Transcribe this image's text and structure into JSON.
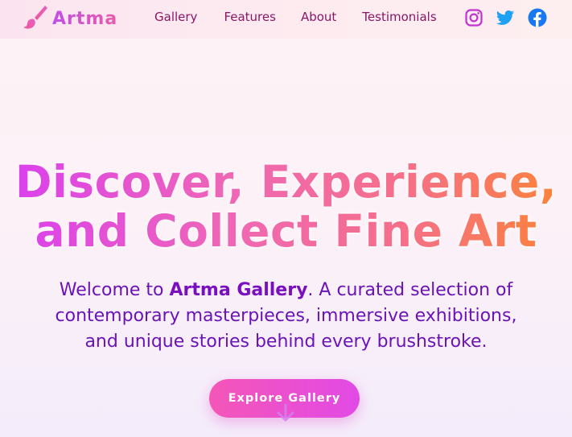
{
  "header": {
    "brand": "Artma",
    "nav": [
      "Gallery",
      "Features",
      "About",
      "Testimonials"
    ],
    "social_icons": [
      "instagram-icon",
      "twitter-icon",
      "facebook-icon"
    ]
  },
  "hero": {
    "title_line1": "Discover, Experience,",
    "title_line2": "and Collect Fine Art",
    "subtitle_pre": "Welcome to ",
    "subtitle_brand": "Artma Gallery",
    "subtitle_line1_rest": ". A curated selection of",
    "subtitle_line2": "contemporary masterpieces, immersive exhibitions,",
    "subtitle_line3": "and unique stories behind every brushstroke.",
    "cta_label": "Explore Gallery"
  },
  "colors": {
    "brand_pink": "#e85aa8",
    "brand_purple": "#c34ee8",
    "nav_text": "#8a1766",
    "subtitle_text": "#6b13b5",
    "instagram": "#c233d1",
    "twitter": "#1da1f2",
    "facebook": "#1877f2"
  }
}
